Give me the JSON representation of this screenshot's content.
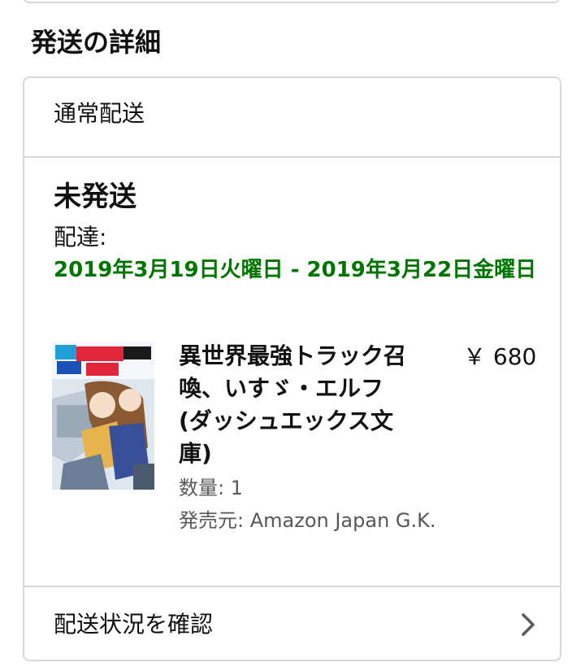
{
  "shipment": {
    "section_title": "発送の詳細",
    "method_label": "通常配送",
    "status": "未発送",
    "delivery_label": "配達:",
    "delivery_dates": "2019年3月19日火曜日 - 2019年3月22日金曜日",
    "track_label": "配送状況を確認",
    "item": {
      "title": "異世界最強トラック召喚、いすゞ・エルフ (ダッシュエックス文庫)",
      "price": "￥ 680",
      "quantity": "数量: 1",
      "seller": "発売元: Amazon Japan G.K."
    }
  },
  "colors": {
    "delivery_green": "#007600",
    "border": "#d5d9d9",
    "secondary_text": "#565959"
  },
  "icons": {
    "track_chevron": "chevron-right-icon",
    "item_cover": "book-cover-image"
  }
}
